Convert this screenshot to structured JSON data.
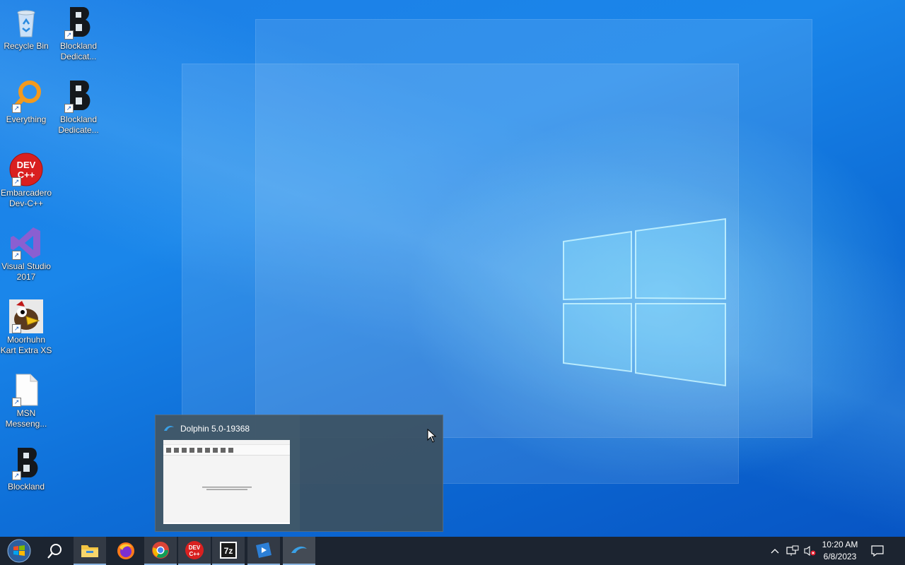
{
  "desktop": {
    "icons": [
      {
        "label": "Recycle Bin"
      },
      {
        "label": "Blockland Dedicat..."
      },
      {
        "label": "Everything"
      },
      {
        "label": "Blockland Dedicate..."
      },
      {
        "label": "Embarcadero Dev-C++"
      },
      {
        "label": "Visual Studio 2017"
      },
      {
        "label": "Moorhuhn Kart Extra XS"
      },
      {
        "label": "MSN Messeng..."
      },
      {
        "label": "Blockland"
      }
    ],
    "dev_badge": "DEV\nC++"
  },
  "preview": {
    "title": "Dolphin 5.0-19368"
  },
  "taskbar": {
    "apps": [
      {
        "name": "file-explorer"
      },
      {
        "name": "firefox"
      },
      {
        "name": "chrome"
      },
      {
        "name": "dev-cpp",
        "badge": "DEV\nC++"
      },
      {
        "name": "7zip",
        "badge": "7z"
      },
      {
        "name": "media-player"
      },
      {
        "name": "dolphin"
      }
    ],
    "clock": {
      "time": "10:20 AM",
      "date": "6/8/2023"
    }
  },
  "colors": {
    "taskbar": "#1c2430",
    "accent": "#8ab4e0",
    "desktop": "#1a86ea"
  }
}
